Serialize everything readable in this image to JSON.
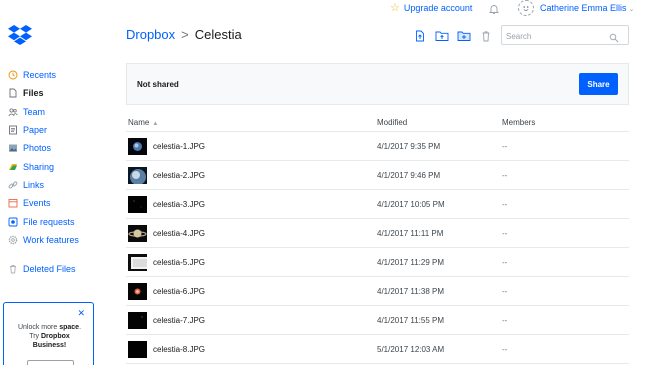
{
  "topbar": {
    "upgrade_label": "Upgrade account",
    "user_name": "Catherine Emma Ellis"
  },
  "sidebar": {
    "items": [
      {
        "label": "Recents",
        "icon": "clock-icon"
      },
      {
        "label": "Files",
        "icon": "file-icon"
      },
      {
        "label": "Team",
        "icon": "team-icon"
      },
      {
        "label": "Paper",
        "icon": "paper-icon"
      },
      {
        "label": "Photos",
        "icon": "photo-icon"
      },
      {
        "label": "Sharing",
        "icon": "sharing-icon"
      },
      {
        "label": "Links",
        "icon": "link-icon"
      },
      {
        "label": "Events",
        "icon": "calendar-icon"
      },
      {
        "label": "File requests",
        "icon": "file-request-icon"
      },
      {
        "label": "Work features",
        "icon": "gear-icon"
      },
      {
        "label": "Deleted Files",
        "icon": "trash-icon"
      }
    ],
    "active": "Files"
  },
  "promo": {
    "line1_a": "Unlock more ",
    "line1_b": "space",
    "line1_c": ".",
    "line2_a": "Try ",
    "line2_b": "Dropbox",
    "line3": "Business",
    "line3_c": "!"
  },
  "breadcrumb": {
    "root": "Dropbox",
    "separator": ">",
    "current": "Celestia"
  },
  "search": {
    "placeholder": "Search"
  },
  "banner": {
    "status": "Not shared",
    "share_label": "Share"
  },
  "table": {
    "columns": {
      "name": "Name",
      "modified": "Modified",
      "members": "Members"
    },
    "rows": [
      {
        "name": "celestia-1.JPG",
        "modified": "4/1/2017 9:35 PM",
        "members": "--"
      },
      {
        "name": "celestia-2.JPG",
        "modified": "4/1/2017 9:46 PM",
        "members": "--"
      },
      {
        "name": "celestia-3.JPG",
        "modified": "4/1/2017 10:05 PM",
        "members": "--"
      },
      {
        "name": "celestia-4.JPG",
        "modified": "4/1/2017 11:11 PM",
        "members": "--"
      },
      {
        "name": "celestia-5.JPG",
        "modified": "4/1/2017 11:29 PM",
        "members": "--"
      },
      {
        "name": "celestia-6.JPG",
        "modified": "4/1/2017 11:38 PM",
        "members": "--"
      },
      {
        "name": "celestia-7.JPG",
        "modified": "4/1/2017 11:55 PM",
        "members": "--"
      },
      {
        "name": "celestia-8.JPG",
        "modified": "5/1/2017 12:03 AM",
        "members": "--"
      }
    ]
  },
  "colors": {
    "accent": "#0061fe",
    "text": "#1e1919",
    "border": "#e6e8ea"
  }
}
